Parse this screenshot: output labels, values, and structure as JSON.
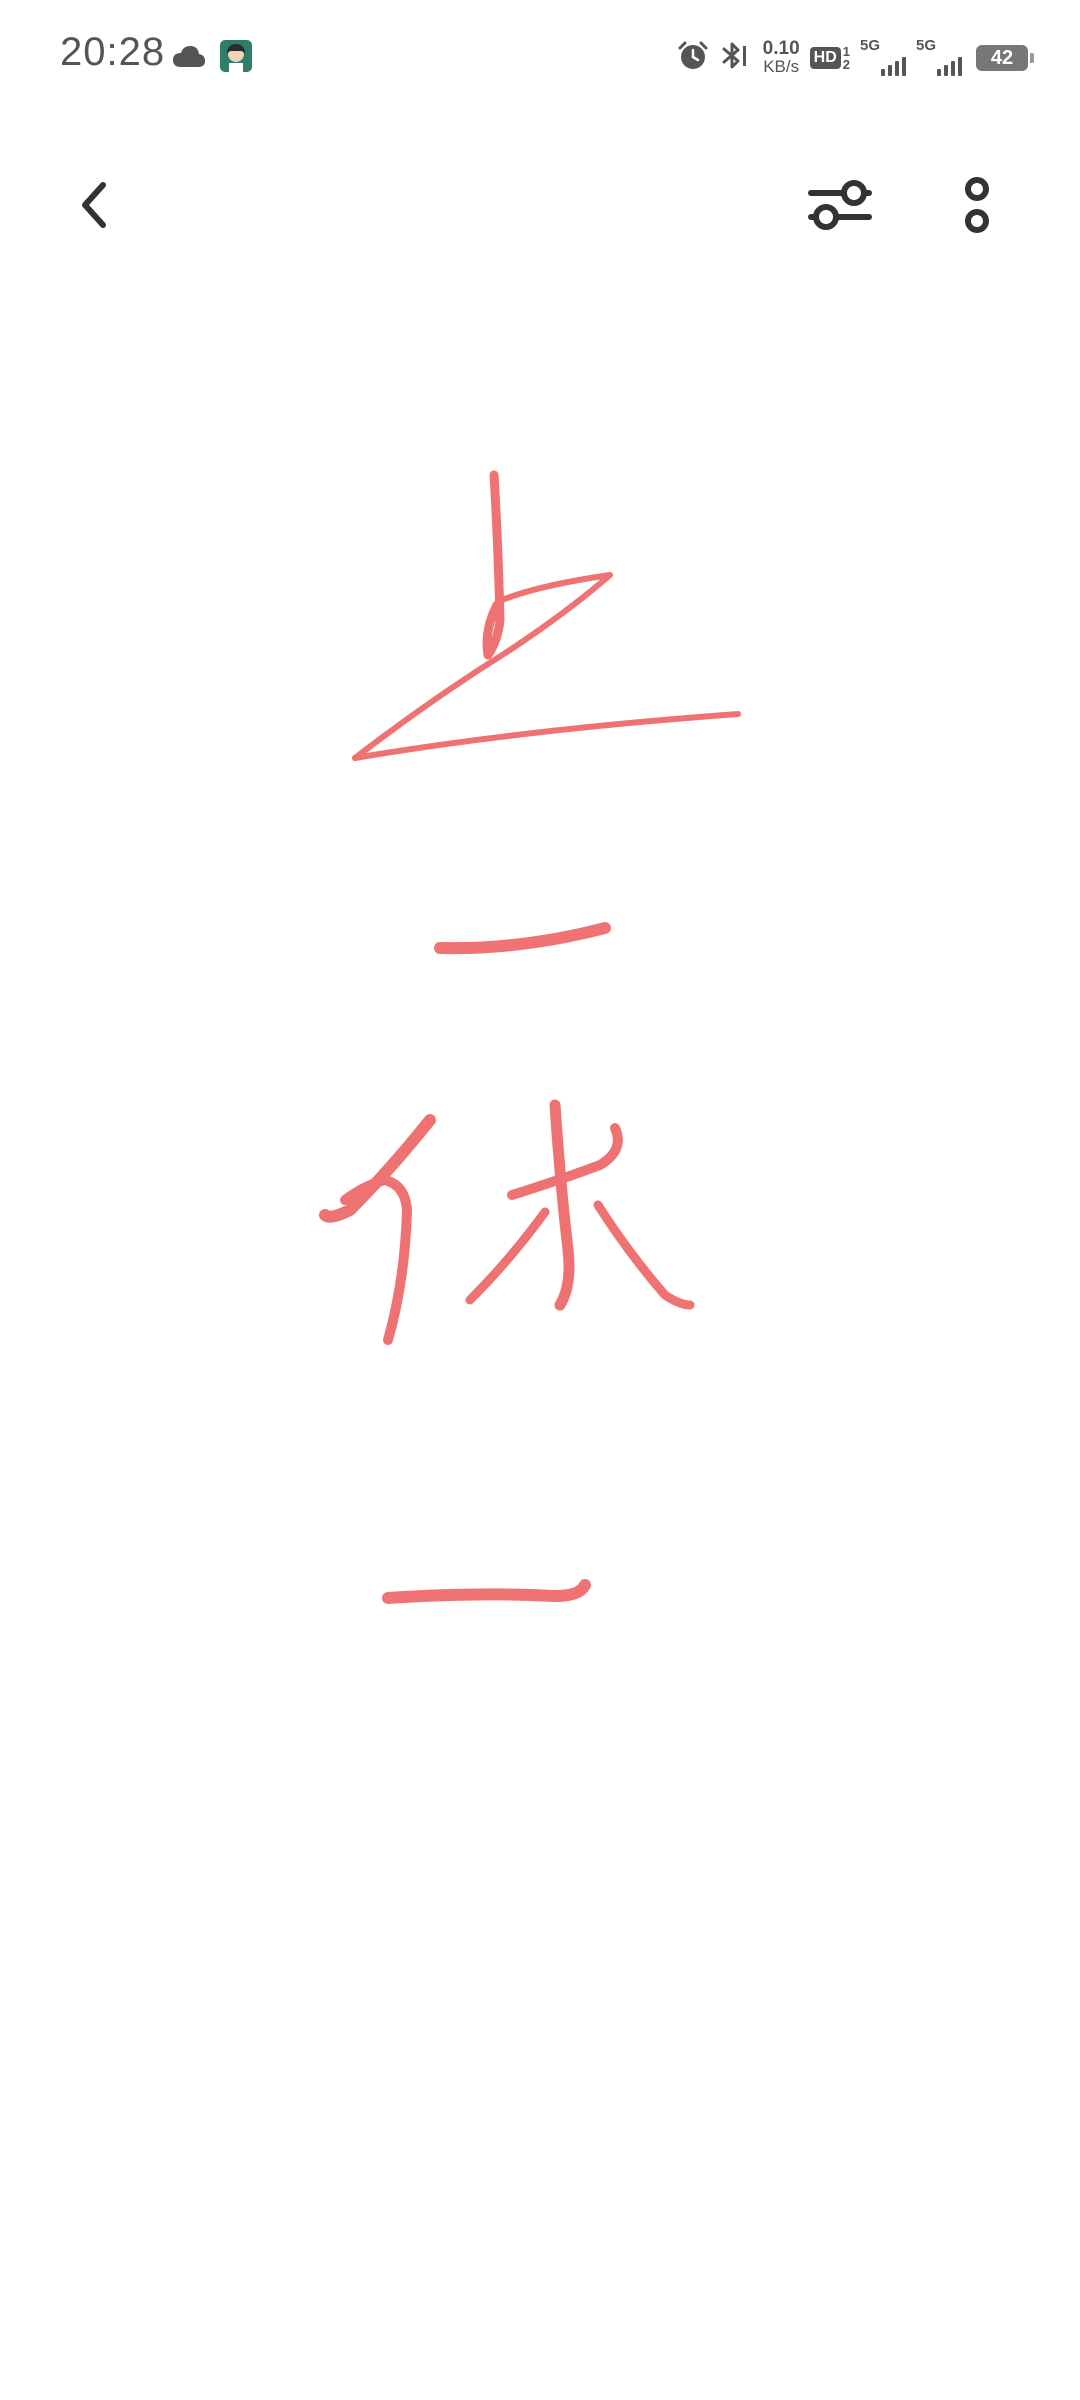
{
  "status_bar": {
    "time": "20:28",
    "net_speed_value": "0.10",
    "net_speed_unit": "KB/s",
    "hd_label": "HD",
    "hd_top": "1",
    "hd_bottom": "2",
    "sim1_label": "5G",
    "sim2_label": "5G",
    "battery_level": "42",
    "icons": [
      "cloud-icon",
      "app-avatar-icon",
      "alarm-icon",
      "bluetooth-icon"
    ]
  },
  "toolbar": {
    "icons": [
      "back-arrow-icon",
      "adjust-sliders-icon",
      "more-vertical-icon"
    ]
  },
  "drawing": {
    "ink_color": "#ef6b6b",
    "strokes": [
      "handwritten-character-1",
      "handwritten-dash-1",
      "handwritten-character-2",
      "handwritten-dash-2"
    ]
  }
}
